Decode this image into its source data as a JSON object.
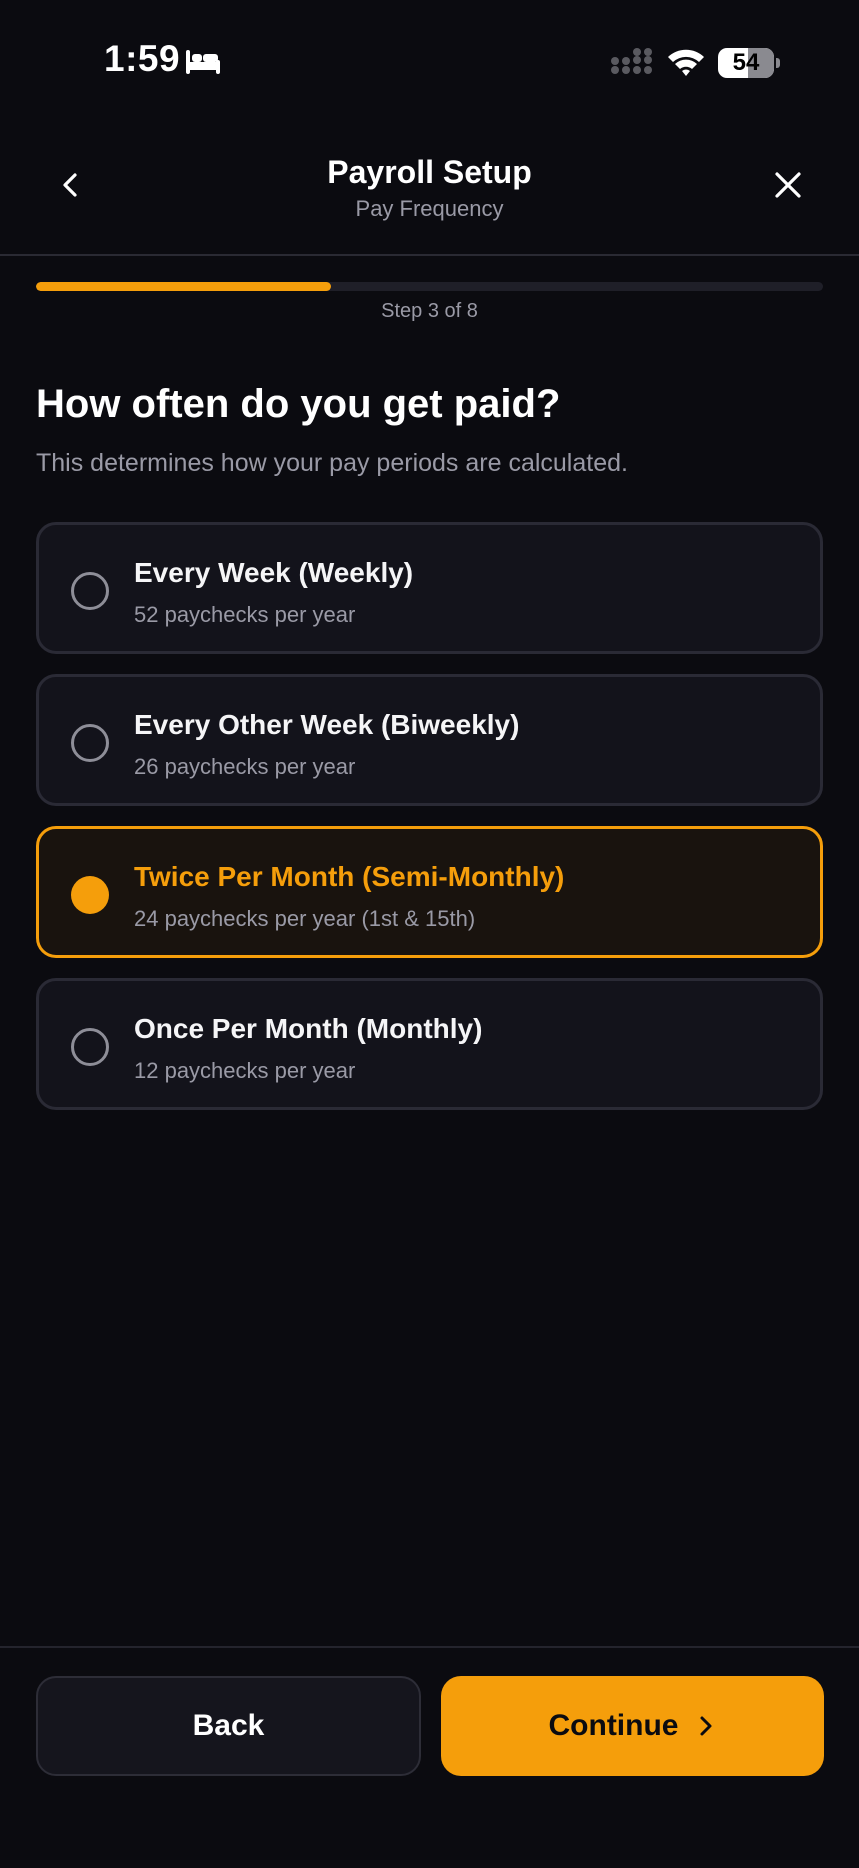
{
  "status_bar": {
    "time": "1:59",
    "battery_level": "54",
    "battery_fraction": 0.54
  },
  "header": {
    "title": "Payroll Setup",
    "subtitle": "Pay Frequency"
  },
  "progress": {
    "label": "Step 3 of 8",
    "current_step": 3,
    "total_steps": 8,
    "fraction": 0.375
  },
  "question": {
    "title": "How often do you get paid?",
    "description": "This determines how your pay periods are calculated."
  },
  "options": [
    {
      "title": "Every Week (Weekly)",
      "subtitle": "52 paychecks per year",
      "selected": false
    },
    {
      "title": "Every Other Week (Biweekly)",
      "subtitle": "26 paychecks per year",
      "selected": false
    },
    {
      "title": "Twice Per Month (Semi-Monthly)",
      "subtitle": "24 paychecks per year (1st & 15th)",
      "selected": true
    },
    {
      "title": "Once Per Month (Monthly)",
      "subtitle": "12 paychecks per year",
      "selected": false
    }
  ],
  "footer": {
    "back_label": "Back",
    "continue_label": "Continue"
  },
  "colors": {
    "accent": "#f59e0b",
    "background": "#0b0b10",
    "card": "#13131b"
  },
  "icons": {
    "back": "chevron-left-icon",
    "close": "close-icon",
    "continue": "chevron-right-icon",
    "status_sleep": "bed-icon",
    "status_signal": "signal-icon",
    "status_wifi": "wifi-icon"
  }
}
